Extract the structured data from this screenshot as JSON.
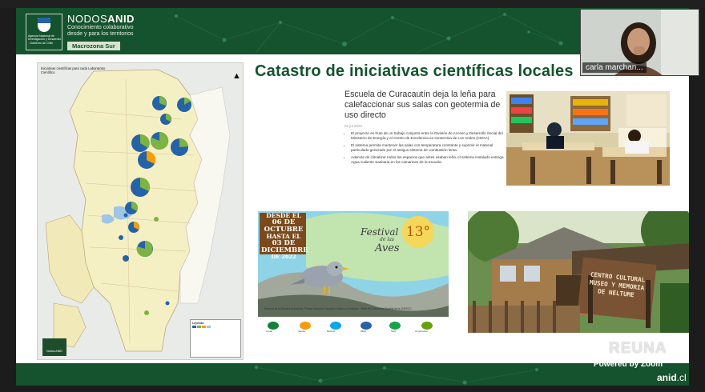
{
  "banner": {
    "logo_text": "Agencia Nacional de Investigación y Desarrollo · Gobierno de Chile",
    "brand_prefix": "NODOS",
    "brand_bold": "ANID",
    "tagline_1": "Conocimiento colaborativo",
    "tagline_2": "desde y para los territorios",
    "zone": "Macrozona Sur"
  },
  "slide": {
    "title": "Catastro de iniciativas científicas locales"
  },
  "map": {
    "title": "Iniciativas científicas para cada Laboratorio Científico",
    "north_label": "▲",
    "legend_title": "Leyenda",
    "logo_label": "Nodos ANID"
  },
  "news": {
    "headline": "Escuela de Curacautín deja la leña para calefaccionar sus salas con geotermia de uso directo",
    "date": "01 jul 2022",
    "bullets": [
      "El proyecto es fruto de un trabajo conjunto entre la División de Acceso y Desarrollo Social del Ministerio de Energía y el Centro de Excelencia en Geotermia de Los Andes (CEGA).",
      "El sistema permite mantener las salas con temperatura constante y suprimir el material particulado generado por el antiguo sistema de combustión lenta.",
      "Además de climatizar todos los espacios que antes usaban leña, el sistema instalado entrega Agua Caliente Sanitaria en los camarines de la escuela."
    ]
  },
  "poster": {
    "date_line_1": "DESDE EL",
    "date_line_2": "06 DE OCTUBRE",
    "date_line_3": "HASTA EL",
    "date_line_4": "03 DE DICIEMBRE",
    "date_line_5": "DE 2022",
    "festival_word": "Festival",
    "de_las": "de las",
    "aves": "Aves",
    "edition": "13°",
    "fine_print": "Reserva de la Biósfera Araucarias, Parque Nacional Conguillío, Malleco y Tolhuaca · Sitios del Patrimonio Mundial de la UNESCO",
    "logos": [
      "Conaf",
      "Senda",
      "BirdLife",
      "MMA",
      "SAG",
      "Corporación"
    ]
  },
  "sign": {
    "text": "CENTRO CULTURAL MUSEO Y MEMORIA DE NELTUME"
  },
  "overlay": {
    "reuna": "REUNA",
    "zoom": "Powered by Zoom",
    "anid_bold": "anid",
    "anid_tld": ".cl"
  },
  "participant": {
    "name": "carla marchan..."
  },
  "colors": {
    "brand_green": "#14532d",
    "title_green": "#14532d",
    "accent_blue": "#2563a8"
  }
}
